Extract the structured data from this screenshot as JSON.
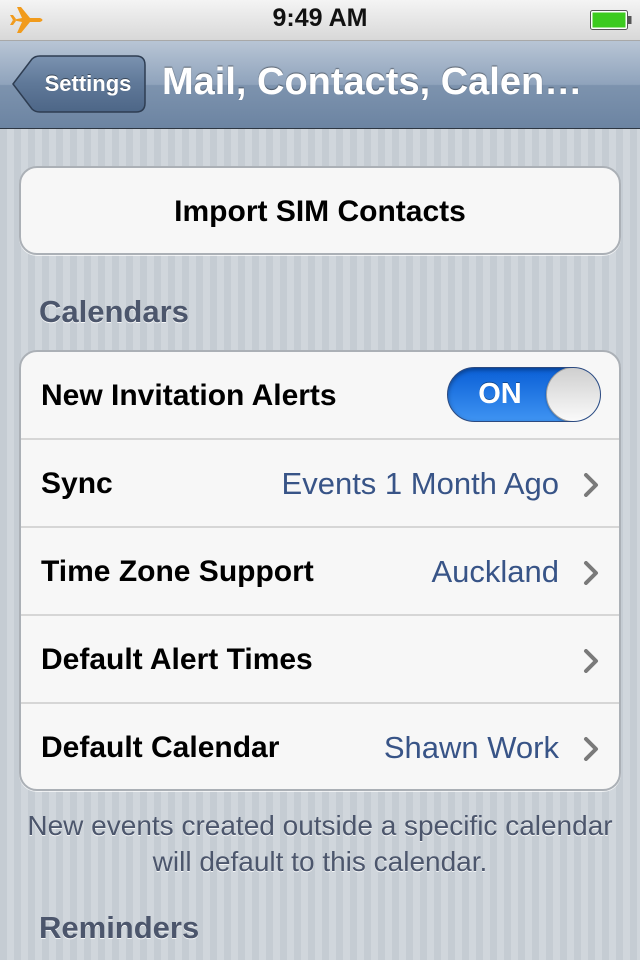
{
  "status_bar": {
    "time": "9:49 AM",
    "airplane_icon": "airplane-icon",
    "battery_icon": "battery-icon",
    "battery_color": "#2ecc1a"
  },
  "nav": {
    "back_label": "Settings",
    "title": "Mail, Contacts, Calen…"
  },
  "import": {
    "label": "Import SIM Contacts"
  },
  "calendars": {
    "header": "Calendars",
    "rows": [
      {
        "label": "New Invitation Alerts",
        "toggle": "ON"
      },
      {
        "label": "Sync",
        "value": "Events 1 Month Ago"
      },
      {
        "label": "Time Zone Support",
        "value": "Auckland"
      },
      {
        "label": "Default Alert Times",
        "value": ""
      },
      {
        "label": "Default Calendar",
        "value": "Shawn Work"
      }
    ],
    "footer": "New events created outside a specific calendar will default to this calendar."
  },
  "reminders": {
    "header": "Reminders"
  },
  "colors": {
    "accent_value": "#385487",
    "toggle_on": "#1a73e8"
  }
}
